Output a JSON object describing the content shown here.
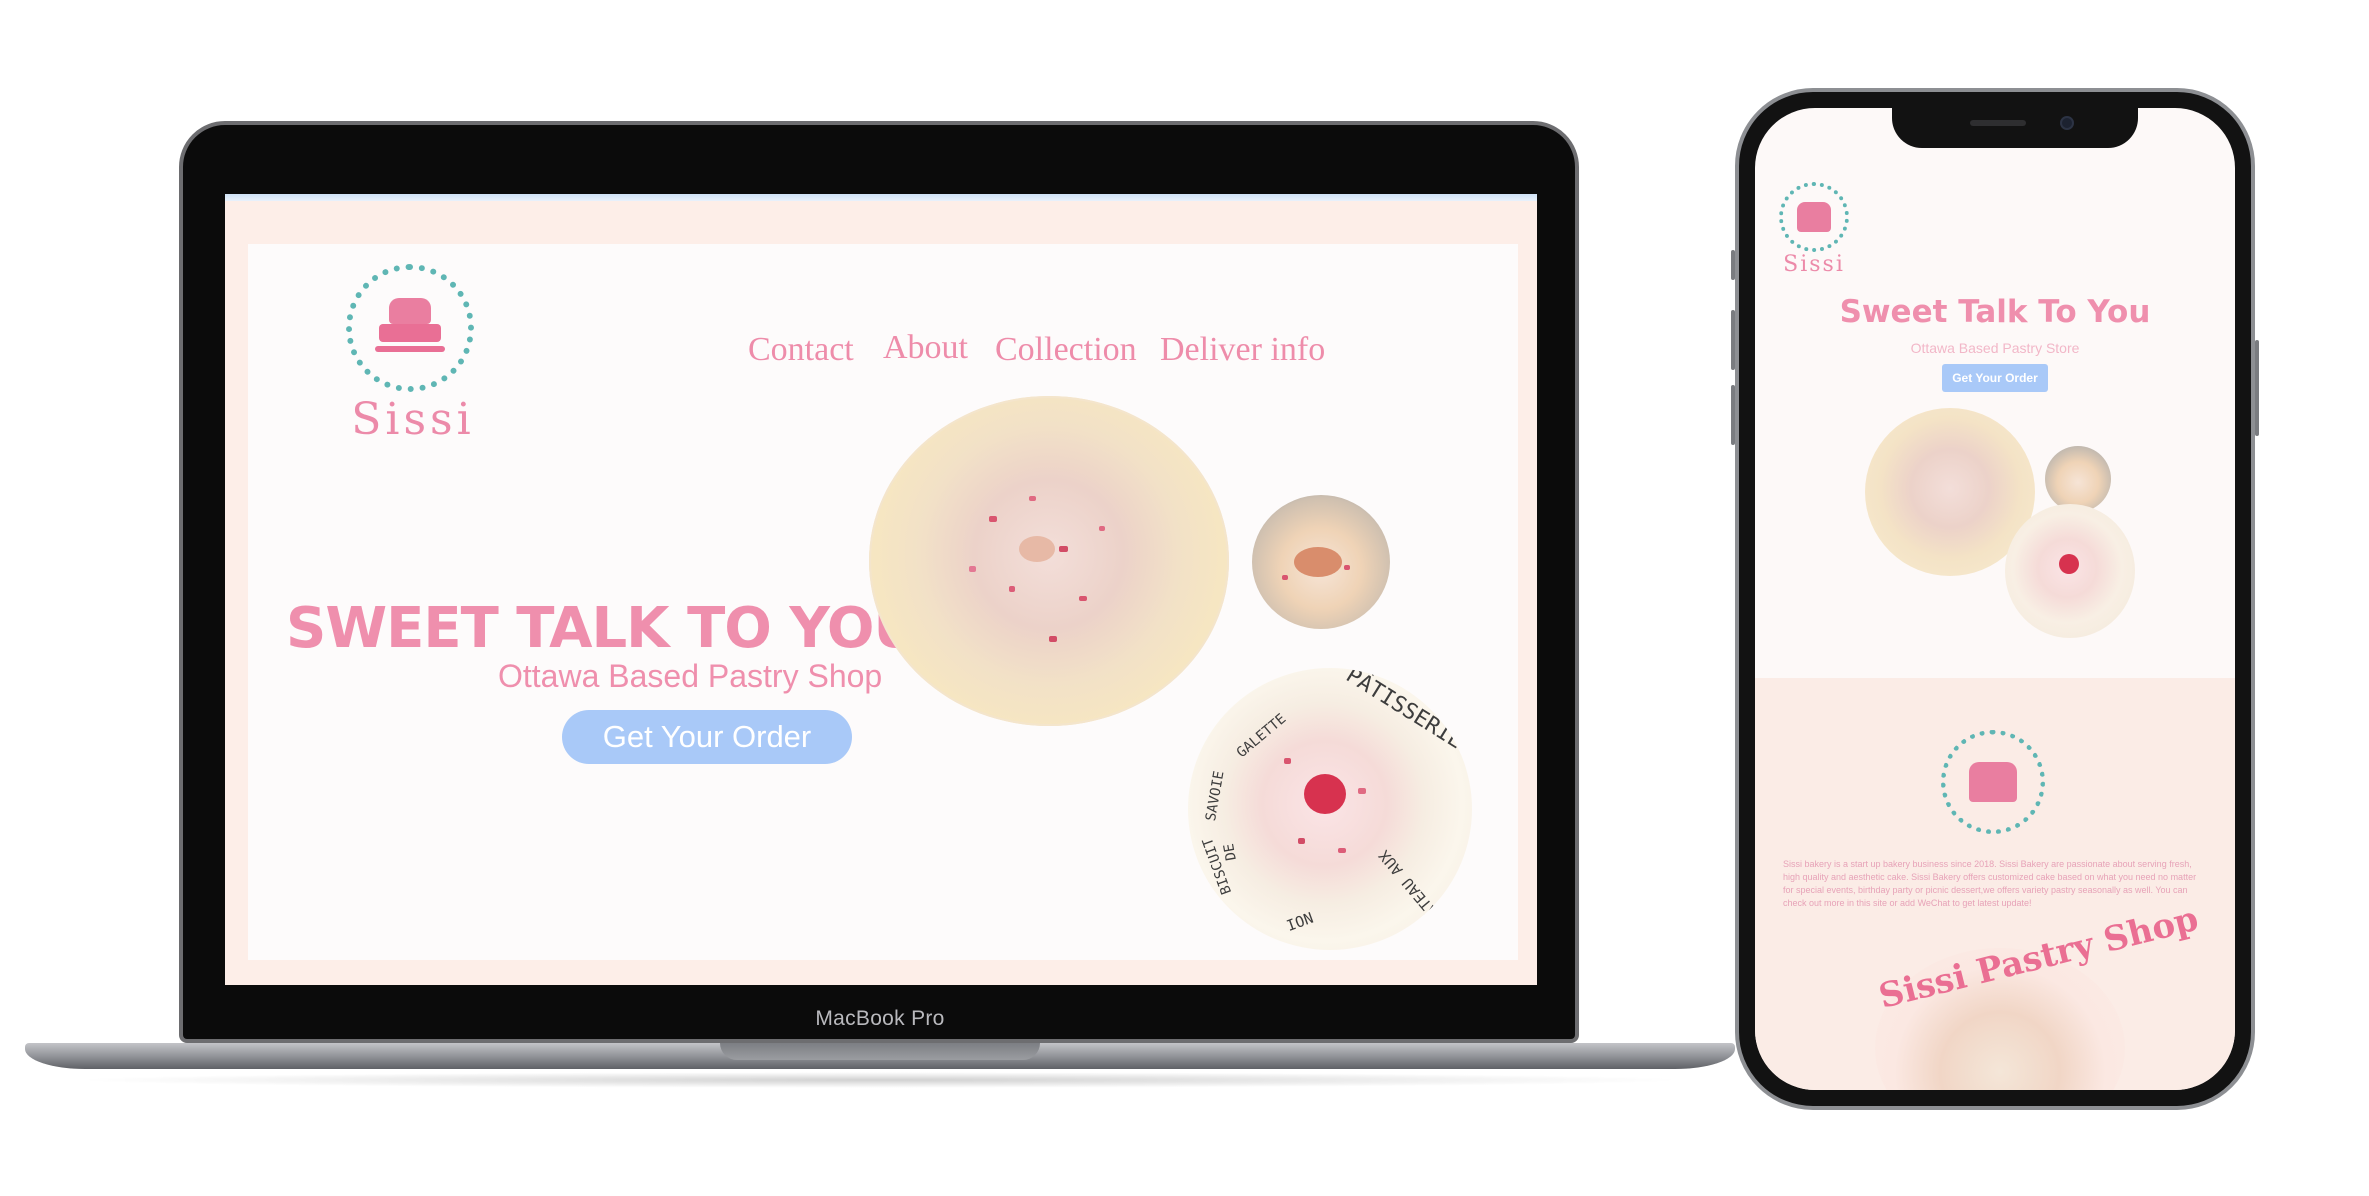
{
  "laptop": {
    "brand_label": "MacBook Pro"
  },
  "site": {
    "logo_word": "Sissi",
    "nav": [
      {
        "label": "Contact"
      },
      {
        "label": "About"
      },
      {
        "label": "Collection"
      },
      {
        "label": "Deliver info"
      }
    ],
    "hero_title": "SWEET TALK TO YOU",
    "hero_subtitle": "Ottawa Based Pastry Shop",
    "cta_label": "Get Your Order",
    "plate_texts": [
      "PÂTISSERIE",
      "GALETTE",
      "SAVOIE",
      "BISCUIT",
      "DE",
      "GÂTEAU AUX",
      "NOI"
    ]
  },
  "mobile": {
    "logo_word": "Sissi",
    "title": "Sweet Talk To You",
    "subtitle": "Ottawa Based Pastry Store",
    "cta_label": "Get Your Order",
    "about_text": "Sissi bakery is a start up bakery business since 2018. Sissi Bakery are passionate about serving fresh, high quality and aesthetic cake. Sissi Bakery offers customized cake based on what you need no matter for special events, birthday party or picnic dessert,we offers variety pastry seasonally as well. You can check out more in this site or add WeChat to get latest update!",
    "shop_text": "Sissi Pastry Shop"
  },
  "colors": {
    "accent_pink": "#ef8fad",
    "button_blue": "#a9c9f8",
    "logo_teal": "#5fb6b4",
    "screen_bg": "#fdeee8"
  }
}
